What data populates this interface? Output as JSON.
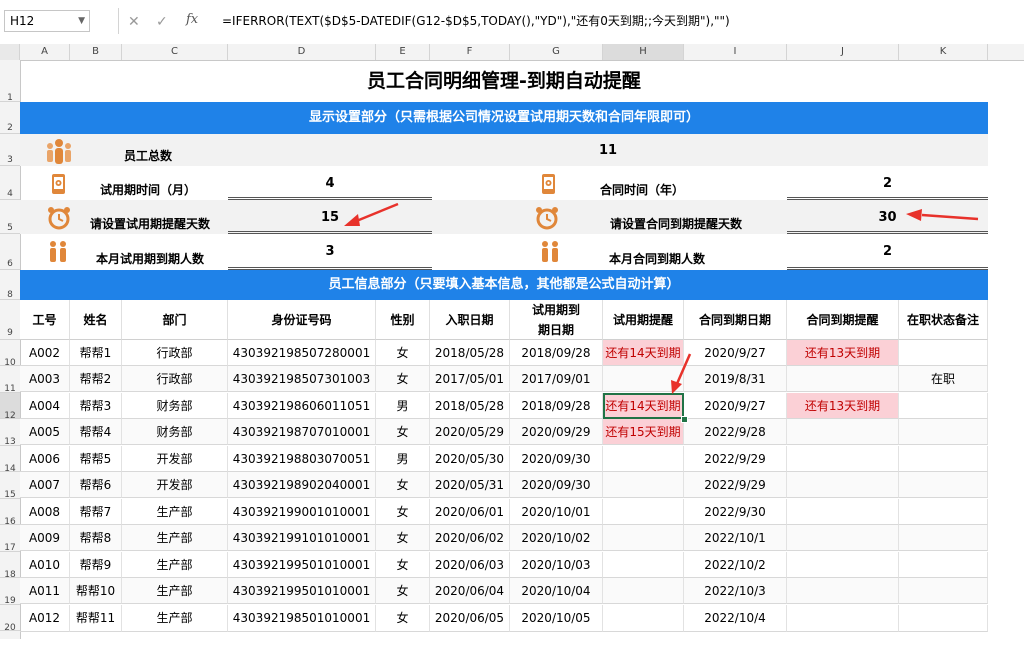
{
  "formula_bar": {
    "cell_ref": "H12",
    "formula": "=IFERROR(TEXT($D$5-DATEDIF(G12-$D$5,TODAY(),\"YD\"),\"还有0天到期;;今天到期\"),\"\")"
  },
  "columns": [
    "A",
    "B",
    "C",
    "D",
    "E",
    "F",
    "G",
    "H",
    "I",
    "J",
    "K"
  ],
  "rows": [
    "1",
    "2",
    "3",
    "4",
    "5",
    "6",
    "8",
    "9",
    "10",
    "11",
    "12",
    "13",
    "14",
    "15",
    "16",
    "17",
    "18",
    "19",
    "20"
  ],
  "title": "员工合同明细管理-到期自动提醒",
  "settings_band": "显示设置部分（只需根据公司情况设置试用期天数和合同年限即可）",
  "settings": {
    "total_label": "员工总数",
    "total_value": "11",
    "trial_time_label": "试用期时间（月）",
    "trial_time_value": "4",
    "contract_time_label": "合同时间（年）",
    "contract_time_value": "2",
    "trial_remind_label": "请设置试用期提醒天数",
    "trial_remind_value": "15",
    "contract_remind_label": "请设置合同到期提醒天数",
    "contract_remind_value": "30",
    "trial_due_label": "本月试用期到期人数",
    "trial_due_value": "3",
    "contract_due_label": "本月合同到期人数",
    "contract_due_value": "2"
  },
  "info_band": "员工信息部分（只要填入基本信息，其他都是公式自动计算）",
  "table": {
    "headers": [
      "工号",
      "姓名",
      "部门",
      "身份证号码",
      "性别",
      "入职日期",
      "试用期到期日期",
      "试用期提醒",
      "合同到期日期",
      "合同到期提醒",
      "在职状态备注"
    ],
    "rows": [
      [
        "A002",
        "帮帮1",
        "行政部",
        "430392198507280001",
        "女",
        "2018/05/28",
        "2018/09/28",
        "还有14天到期",
        "2020/9/27",
        "还有13天到期",
        ""
      ],
      [
        "A003",
        "帮帮2",
        "行政部",
        "430392198507301003",
        "女",
        "2017/05/01",
        "2017/09/01",
        "",
        "2019/8/31",
        "",
        "在职"
      ],
      [
        "A004",
        "帮帮3",
        "财务部",
        "430392198606011051",
        "男",
        "2018/05/28",
        "2018/09/28",
        "还有14天到期",
        "2020/9/27",
        "还有13天到期",
        ""
      ],
      [
        "A005",
        "帮帮4",
        "财务部",
        "430392198707010001",
        "女",
        "2020/05/29",
        "2020/09/29",
        "还有15天到期",
        "2022/9/28",
        "",
        ""
      ],
      [
        "A006",
        "帮帮5",
        "开发部",
        "430392198803070051",
        "男",
        "2020/05/30",
        "2020/09/30",
        "",
        "2022/9/29",
        "",
        ""
      ],
      [
        "A007",
        "帮帮6",
        "开发部",
        "430392198902040001",
        "女",
        "2020/05/31",
        "2020/09/30",
        "",
        "2022/9/29",
        "",
        ""
      ],
      [
        "A008",
        "帮帮7",
        "生产部",
        "430392199001010001",
        "女",
        "2020/06/01",
        "2020/10/01",
        "",
        "2022/9/30",
        "",
        ""
      ],
      [
        "A009",
        "帮帮8",
        "生产部",
        "430392199101010001",
        "女",
        "2020/06/02",
        "2020/10/02",
        "",
        "2022/10/1",
        "",
        ""
      ],
      [
        "A010",
        "帮帮9",
        "生产部",
        "430392199501010001",
        "女",
        "2020/06/03",
        "2020/10/03",
        "",
        "2022/10/2",
        "",
        ""
      ],
      [
        "A011",
        "帮帮10",
        "生产部",
        "430392199501010001",
        "女",
        "2020/06/04",
        "2020/10/04",
        "",
        "2022/10/3",
        "",
        ""
      ],
      [
        "A012",
        "帮帮11",
        "生产部",
        "430392198501010001",
        "女",
        "2020/06/05",
        "2020/10/05",
        "",
        "2022/10/4",
        "",
        ""
      ]
    ]
  },
  "colors": {
    "band": "#1f82e8",
    "alert_bg": "#fbd0d6",
    "alert_text": "#c00000",
    "arrow": "#e8322b",
    "icon": "#e0873a"
  }
}
